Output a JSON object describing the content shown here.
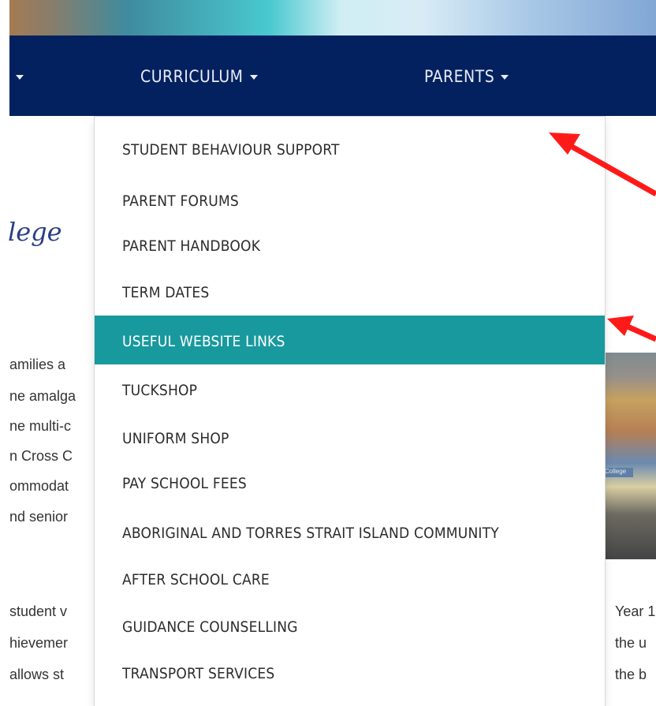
{
  "nav": {
    "prev_label": "",
    "curriculum_label": "CURRICULUM",
    "parents_label": "PARENTS"
  },
  "page": {
    "college_title": "lege",
    "body_left": [
      "amilies a",
      "ne amalga",
      "ne multi-c",
      "n Cross C",
      "ommodat",
      "nd senior"
    ],
    "body_bottom_left": [
      "student v",
      "hievemer",
      "allows st"
    ],
    "body_bottom_right": [
      "Year 1",
      "the u",
      "the b"
    ],
    "photo_sign": "College"
  },
  "dropdown": {
    "items": [
      "STUDENT BEHAVIOUR SUPPORT",
      "PARENT FORUMS",
      "PARENT HANDBOOK",
      "TERM DATES",
      "USEFUL WEBSITE LINKS",
      "TUCKSHOP",
      "UNIFORM SHOP",
      "PAY SCHOOL FEES",
      "ABORIGINAL AND TORRES STRAIT ISLAND COMMUNITY",
      "AFTER SCHOOL CARE",
      "GUIDANCE COUNSELLING",
      "TRANSPORT SERVICES"
    ],
    "active_index": 4
  },
  "colors": {
    "navbar": "#04215f",
    "active_item": "#18999e",
    "annotation_arrow": "#ff1a1a"
  }
}
